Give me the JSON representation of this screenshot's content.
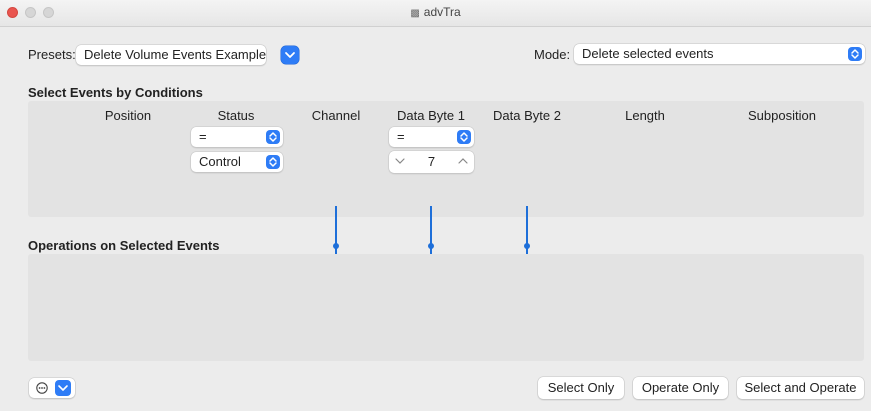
{
  "window": {
    "title": "advTra",
    "title_icon": "document-icon"
  },
  "presets": {
    "label": "Presets:",
    "value": "Delete Volume Events Example"
  },
  "mode": {
    "label": "Mode:",
    "value": "Delete selected events"
  },
  "select_section": {
    "title": "Select Events by Conditions",
    "columns": [
      "Position",
      "Status",
      "Channel",
      "Data Byte 1",
      "Data Byte 2",
      "Length",
      "Subposition"
    ],
    "status_operator": "=",
    "status_value": "Control",
    "byte1_operator": "=",
    "byte1_value": "7"
  },
  "operations_section": {
    "title": "Operations on Selected Events"
  },
  "buttons": {
    "select_only": "Select Only",
    "operate_only": "Operate Only",
    "select_and_operate": "Select and Operate"
  },
  "colors": {
    "accent": "#2e7cf6",
    "line": "#1e6fd9"
  }
}
